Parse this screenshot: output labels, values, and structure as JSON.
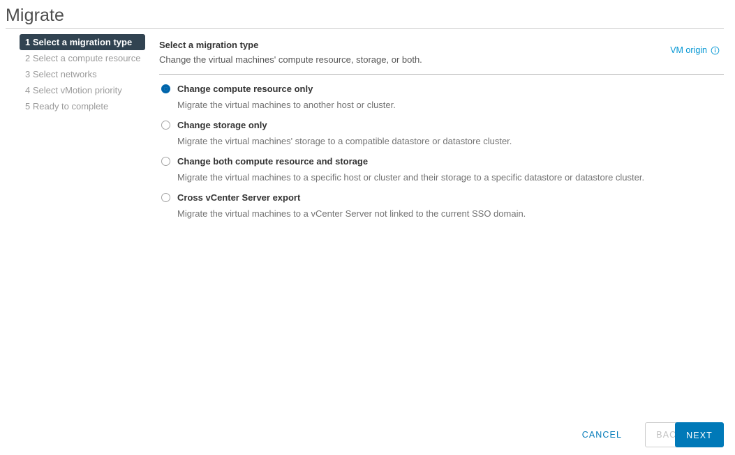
{
  "window": {
    "title": "Migrate"
  },
  "colors": {
    "accent_blue": "#0079b8",
    "link_blue": "#0095d3",
    "radio_selected": "#0065ab",
    "active_step_bg": "#314351",
    "inactive_step_text": "#9a9a9a",
    "disabled_text": "#c1c1c1"
  },
  "nav": {
    "steps": [
      {
        "number": "1",
        "label": "Select a migration type",
        "active": true
      },
      {
        "number": "2",
        "label": "Select a compute resource",
        "active": false
      },
      {
        "number": "3",
        "label": "Select networks",
        "active": false
      },
      {
        "number": "4",
        "label": "Select vMotion priority",
        "active": false
      },
      {
        "number": "5",
        "label": "Ready to complete",
        "active": false
      }
    ]
  },
  "content": {
    "title": "Select a migration type",
    "subtitle": "Change the virtual machines' compute resource, storage, or both.",
    "vm_origin": {
      "label": "VM origin",
      "icon": "info-circle-icon"
    },
    "options": [
      {
        "label": "Change compute resource only",
        "description": "Migrate the virtual machines to another host or cluster.",
        "selected": true
      },
      {
        "label": "Change storage only",
        "description": "Migrate the virtual machines' storage to a compatible datastore or datastore cluster.",
        "selected": false
      },
      {
        "label": "Change both compute resource and storage",
        "description": "Migrate the virtual machines to a specific host or cluster and their storage to a specific datastore or datastore cluster.",
        "selected": false
      },
      {
        "label": "Cross vCenter Server export",
        "description": "Migrate the virtual machines to a vCenter Server not linked to the current SSO domain.",
        "selected": false
      }
    ]
  },
  "footer": {
    "cancel_label": "CANCEL",
    "back_label": "BACK",
    "back_disabled": true,
    "next_label": "NEXT"
  }
}
